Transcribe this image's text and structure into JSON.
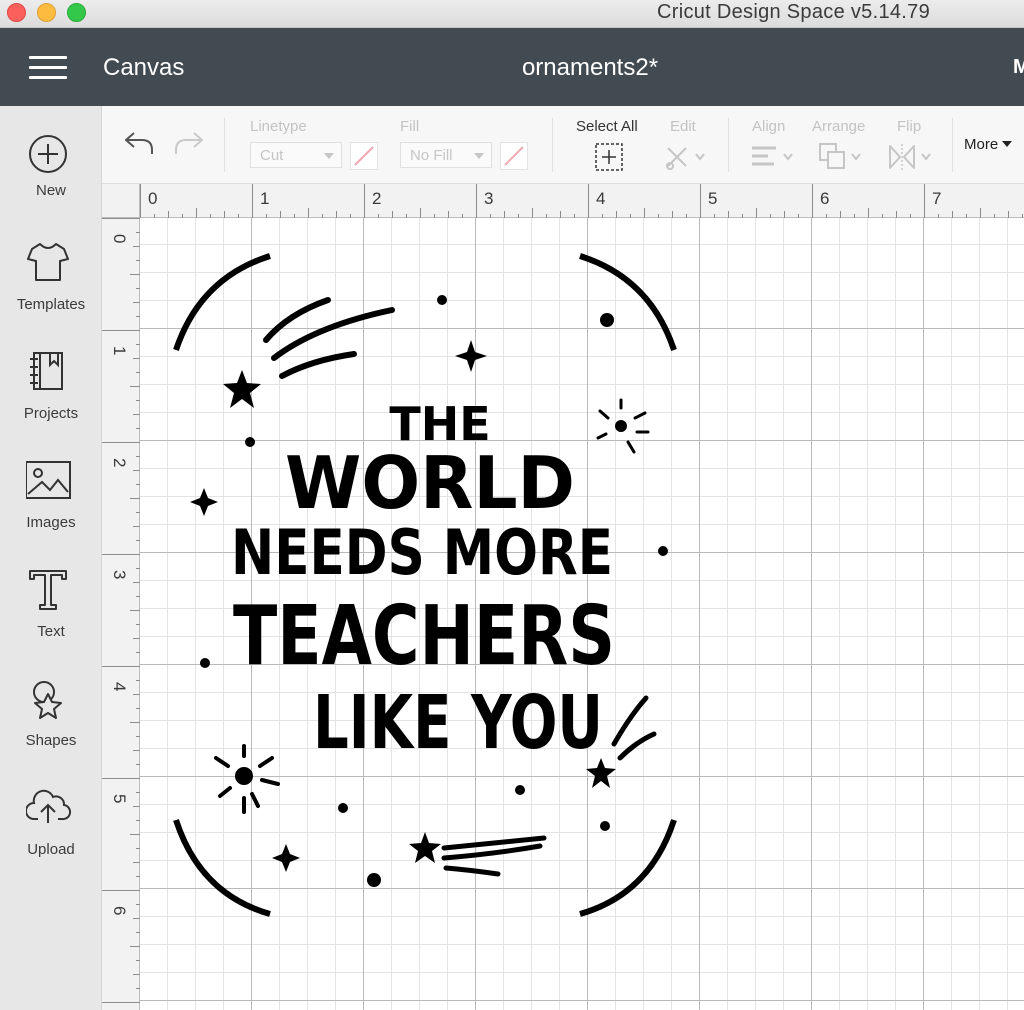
{
  "window": {
    "title": "Cricut Design Space  v5.14.79"
  },
  "header": {
    "section": "Canvas",
    "project_name": "ornaments2*",
    "right_cut": "M"
  },
  "sidebar": {
    "items": [
      {
        "label": "New",
        "icon": "plus-circle-icon"
      },
      {
        "label": "Templates",
        "icon": "tshirt-icon"
      },
      {
        "label": "Projects",
        "icon": "notebook-icon"
      },
      {
        "label": "Images",
        "icon": "image-icon"
      },
      {
        "label": "Text",
        "icon": "text-t-icon"
      },
      {
        "label": "Shapes",
        "icon": "shapes-icon"
      },
      {
        "label": "Upload",
        "icon": "cloud-upload-icon"
      }
    ]
  },
  "toolbar": {
    "linetype_label": "Linetype",
    "linetype_value": "Cut",
    "fill_label": "Fill",
    "fill_value": "No Fill",
    "select_all_label": "Select All",
    "edit_label": "Edit",
    "align_label": "Align",
    "arrange_label": "Arrange",
    "flip_label": "Flip",
    "more_label": "More"
  },
  "rulers": {
    "horizontal": [
      "0",
      "1",
      "2",
      "3",
      "4",
      "5",
      "6",
      "7"
    ],
    "vertical": [
      "0",
      "1",
      "2",
      "3",
      "4",
      "5",
      "6"
    ]
  },
  "design": {
    "lines": [
      "THE",
      "WORLD",
      "NEEDS MORE",
      "TEACHERS",
      "LIKE YOU"
    ],
    "color": "#000000"
  },
  "colors": {
    "header_bg": "#424a52",
    "sidebar_bg": "#e7e7e7",
    "toolbar_bg": "#f7f7f7",
    "disabled_text": "#c3c3c3"
  }
}
